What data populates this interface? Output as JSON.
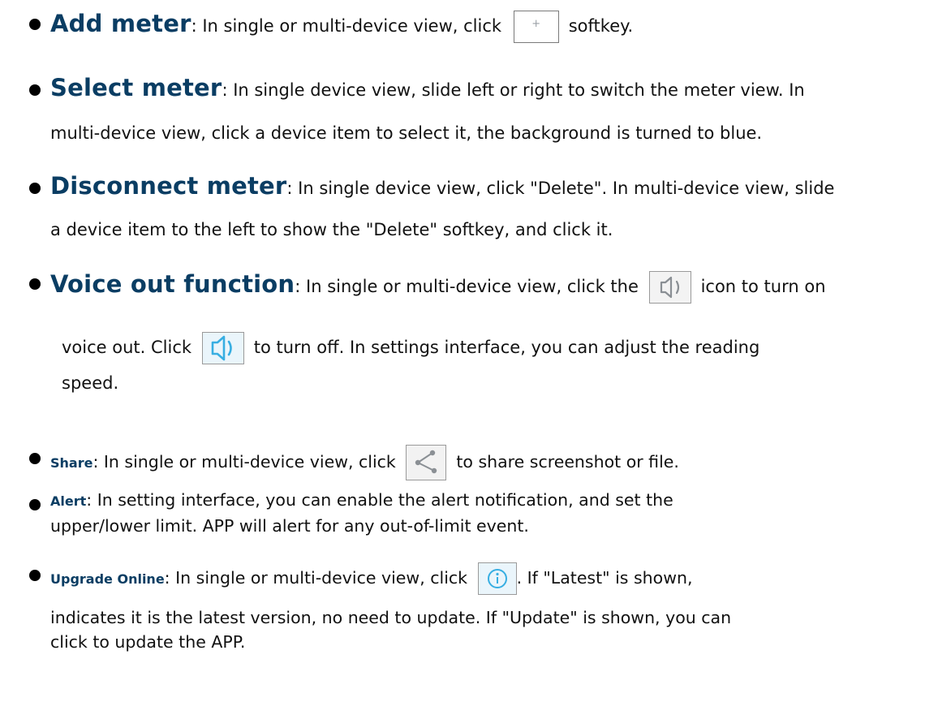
{
  "items": [
    {
      "title": "Add meter",
      "lines": [
        {
          "pre": ": In single or multi-device view, click",
          "post": "softkey."
        }
      ]
    },
    {
      "title": "Select meter",
      "lines": [
        {
          "text": ": In single device view, slide left or right to switch the meter view. In"
        },
        {
          "text": "multi-device view, click a device item to select it, the background is turned to blue."
        }
      ]
    },
    {
      "title": "Disconnect meter",
      "lines": [
        {
          "text": ": In single device view, click \"Delete\". In multi-device view, slide"
        },
        {
          "text": "a device item to the left to show the \"Delete\" softkey, and click it."
        }
      ]
    },
    {
      "title": "Voice out function",
      "lines": [
        {
          "pre": ": In single or multi-device view, click the",
          "post": "icon to turn on"
        },
        {
          "pre": "voice out. Click",
          "post": "to turn off. In settings interface, you can adjust the reading"
        },
        {
          "text": "speed."
        }
      ]
    },
    {
      "title": "Share",
      "lines": [
        {
          "pre": ": In single or multi-device view, click",
          "post": "to share screenshot or file."
        }
      ]
    },
    {
      "title": "Alert",
      "lines": [
        {
          "text": ": In setting interface, you can enable the alert notification, and set the"
        },
        {
          "text": "upper/lower limit. APP will alert for any out-of-limit event."
        }
      ]
    },
    {
      "title": "Upgrade Online",
      "lines": [
        {
          "pre": ": In single or multi-device view, click",
          "post": ". If \"Latest\" is shown,"
        },
        {
          "text": "indicates it is the latest version, no need to update. If \"Update\" is shown, you can"
        },
        {
          "text": "click to update the APP."
        }
      ]
    }
  ],
  "icons": {
    "plus": "+",
    "plus_icon": "plus-icon",
    "speaker_icon": "speaker-icon",
    "share_icon": "share-icon",
    "info_icon": "info-icon",
    "icon_gray": "#8a8f94",
    "icon_blue": "#37aee2"
  }
}
